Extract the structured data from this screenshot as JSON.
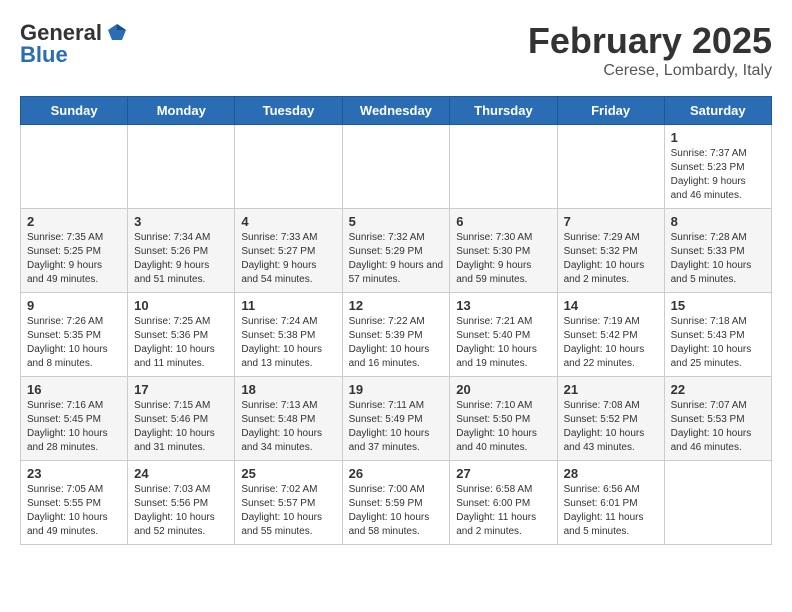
{
  "header": {
    "logo_general": "General",
    "logo_blue": "Blue",
    "month": "February 2025",
    "location": "Cerese, Lombardy, Italy"
  },
  "days_of_week": [
    "Sunday",
    "Monday",
    "Tuesday",
    "Wednesday",
    "Thursday",
    "Friday",
    "Saturday"
  ],
  "weeks": [
    [
      {
        "day": "",
        "info": ""
      },
      {
        "day": "",
        "info": ""
      },
      {
        "day": "",
        "info": ""
      },
      {
        "day": "",
        "info": ""
      },
      {
        "day": "",
        "info": ""
      },
      {
        "day": "",
        "info": ""
      },
      {
        "day": "1",
        "info": "Sunrise: 7:37 AM\nSunset: 5:23 PM\nDaylight: 9 hours and 46 minutes."
      }
    ],
    [
      {
        "day": "2",
        "info": "Sunrise: 7:35 AM\nSunset: 5:25 PM\nDaylight: 9 hours and 49 minutes."
      },
      {
        "day": "3",
        "info": "Sunrise: 7:34 AM\nSunset: 5:26 PM\nDaylight: 9 hours and 51 minutes."
      },
      {
        "day": "4",
        "info": "Sunrise: 7:33 AM\nSunset: 5:27 PM\nDaylight: 9 hours and 54 minutes."
      },
      {
        "day": "5",
        "info": "Sunrise: 7:32 AM\nSunset: 5:29 PM\nDaylight: 9 hours and 57 minutes."
      },
      {
        "day": "6",
        "info": "Sunrise: 7:30 AM\nSunset: 5:30 PM\nDaylight: 9 hours and 59 minutes."
      },
      {
        "day": "7",
        "info": "Sunrise: 7:29 AM\nSunset: 5:32 PM\nDaylight: 10 hours and 2 minutes."
      },
      {
        "day": "8",
        "info": "Sunrise: 7:28 AM\nSunset: 5:33 PM\nDaylight: 10 hours and 5 minutes."
      }
    ],
    [
      {
        "day": "9",
        "info": "Sunrise: 7:26 AM\nSunset: 5:35 PM\nDaylight: 10 hours and 8 minutes."
      },
      {
        "day": "10",
        "info": "Sunrise: 7:25 AM\nSunset: 5:36 PM\nDaylight: 10 hours and 11 minutes."
      },
      {
        "day": "11",
        "info": "Sunrise: 7:24 AM\nSunset: 5:38 PM\nDaylight: 10 hours and 13 minutes."
      },
      {
        "day": "12",
        "info": "Sunrise: 7:22 AM\nSunset: 5:39 PM\nDaylight: 10 hours and 16 minutes."
      },
      {
        "day": "13",
        "info": "Sunrise: 7:21 AM\nSunset: 5:40 PM\nDaylight: 10 hours and 19 minutes."
      },
      {
        "day": "14",
        "info": "Sunrise: 7:19 AM\nSunset: 5:42 PM\nDaylight: 10 hours and 22 minutes."
      },
      {
        "day": "15",
        "info": "Sunrise: 7:18 AM\nSunset: 5:43 PM\nDaylight: 10 hours and 25 minutes."
      }
    ],
    [
      {
        "day": "16",
        "info": "Sunrise: 7:16 AM\nSunset: 5:45 PM\nDaylight: 10 hours and 28 minutes."
      },
      {
        "day": "17",
        "info": "Sunrise: 7:15 AM\nSunset: 5:46 PM\nDaylight: 10 hours and 31 minutes."
      },
      {
        "day": "18",
        "info": "Sunrise: 7:13 AM\nSunset: 5:48 PM\nDaylight: 10 hours and 34 minutes."
      },
      {
        "day": "19",
        "info": "Sunrise: 7:11 AM\nSunset: 5:49 PM\nDaylight: 10 hours and 37 minutes."
      },
      {
        "day": "20",
        "info": "Sunrise: 7:10 AM\nSunset: 5:50 PM\nDaylight: 10 hours and 40 minutes."
      },
      {
        "day": "21",
        "info": "Sunrise: 7:08 AM\nSunset: 5:52 PM\nDaylight: 10 hours and 43 minutes."
      },
      {
        "day": "22",
        "info": "Sunrise: 7:07 AM\nSunset: 5:53 PM\nDaylight: 10 hours and 46 minutes."
      }
    ],
    [
      {
        "day": "23",
        "info": "Sunrise: 7:05 AM\nSunset: 5:55 PM\nDaylight: 10 hours and 49 minutes."
      },
      {
        "day": "24",
        "info": "Sunrise: 7:03 AM\nSunset: 5:56 PM\nDaylight: 10 hours and 52 minutes."
      },
      {
        "day": "25",
        "info": "Sunrise: 7:02 AM\nSunset: 5:57 PM\nDaylight: 10 hours and 55 minutes."
      },
      {
        "day": "26",
        "info": "Sunrise: 7:00 AM\nSunset: 5:59 PM\nDaylight: 10 hours and 58 minutes."
      },
      {
        "day": "27",
        "info": "Sunrise: 6:58 AM\nSunset: 6:00 PM\nDaylight: 11 hours and 2 minutes."
      },
      {
        "day": "28",
        "info": "Sunrise: 6:56 AM\nSunset: 6:01 PM\nDaylight: 11 hours and 5 minutes."
      },
      {
        "day": "",
        "info": ""
      }
    ]
  ]
}
